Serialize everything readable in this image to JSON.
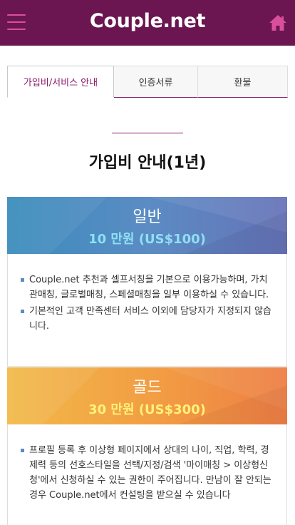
{
  "header": {
    "logo": "Couple.net",
    "menu_icon": "hamburger-menu-icon",
    "home_icon": "home-icon",
    "bg_color": "#6b1650",
    "icon_color": "#d94f9c"
  },
  "tabs": [
    {
      "label": "가입비/서비스 안내",
      "active": true
    },
    {
      "label": "인증서류",
      "active": false
    },
    {
      "label": "환불",
      "active": false
    }
  ],
  "section": {
    "title": "가입비 안내(1년)"
  },
  "plans": [
    {
      "name": "일반",
      "price": "10 만원 (US$100)",
      "features": [
        "Couple.net 추천과 셀프서칭을 기본으로 이용가능하며, 가치관매칭, 글로벌매칭, 스페셜매칭을 일부 이용하실 수 있습니다.",
        "기본적인 고객 만족센터 서비스 이외에 담당자가 지정되지 않습니다."
      ]
    },
    {
      "name": "골드",
      "price": "30 만원 (US$300)",
      "features": [
        "프로필 등록 후 이상형 페이지에서 상대의 나이, 직업, 학력, 경제력 등의 선호스타일을 선택/지정/검색 '마이매칭 > 이상형신청'에서 신청하실 수 있는 권한이 주어집니다. 만남이 잘 안되는 경우 Couple.net에서 컨설팅을 받으실 수 있습니다"
      ]
    }
  ],
  "colors": {
    "accent": "#8a1a6a",
    "general_price": "#8ee0f3",
    "gold_price": "#fff27a",
    "bullet": "#5b8cc3"
  }
}
